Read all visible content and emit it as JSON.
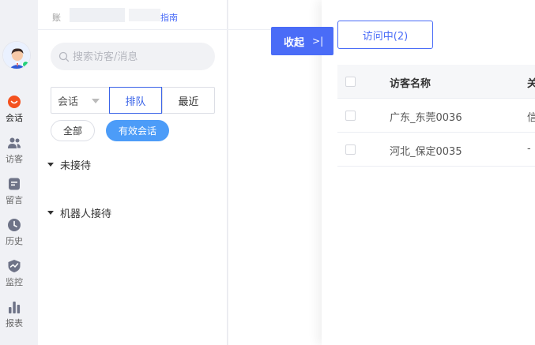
{
  "topbar": {
    "prefix": "账",
    "guide_link": "指南"
  },
  "rail": {
    "items": [
      {
        "label": "会话",
        "icon": "chat-icon"
      },
      {
        "label": "访客",
        "icon": "visitors-icon"
      },
      {
        "label": "留言",
        "icon": "message-note-icon"
      },
      {
        "label": "历史",
        "icon": "clock-icon"
      },
      {
        "label": "监控",
        "icon": "monitor-icon"
      },
      {
        "label": "报表",
        "icon": "bar-chart-icon"
      }
    ]
  },
  "search": {
    "placeholder": "搜索访客/消息",
    "value": ""
  },
  "filters": {
    "select_value": "会话",
    "tabs": [
      "排队",
      "最近"
    ],
    "active_tab": "排队",
    "pill_all": "全部",
    "pill_valid": "有效会话"
  },
  "groups": [
    "未接待",
    "机器人接待"
  ],
  "collapse_button": {
    "label": "收起",
    "arrow": ">|"
  },
  "drawer": {
    "tab_label": "访问中(2)",
    "columns": [
      "访客名称",
      "关"
    ],
    "rows": [
      {
        "name": "广东_东莞0036",
        "rel": "信"
      },
      {
        "name": "河北_保定0035",
        "rel": "-"
      }
    ]
  },
  "colors": {
    "accent": "#4a6cf7",
    "pill_blue": "#4c9cf8",
    "chat_red": "#f4511e",
    "online": "#26d07c",
    "rail_icon": "#6e7387"
  }
}
